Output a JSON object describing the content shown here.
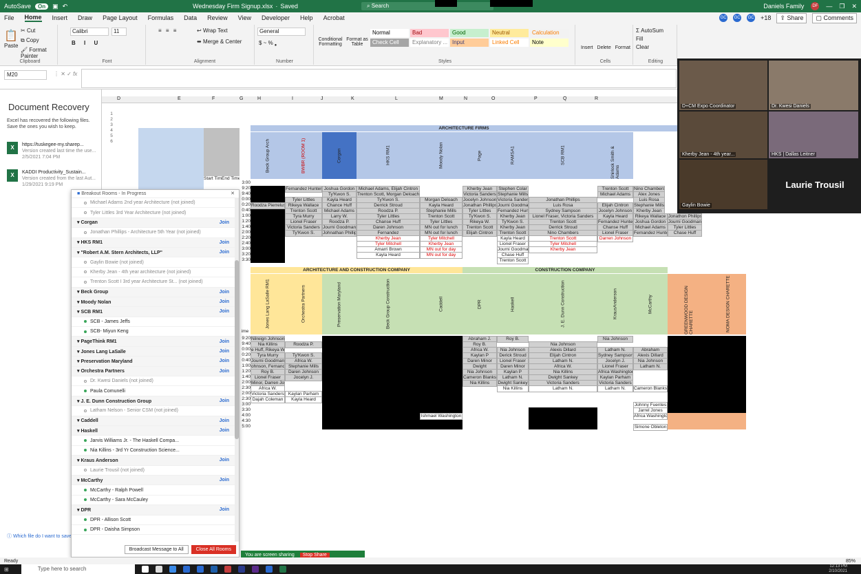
{
  "titlebar": {
    "autosave": "AutoSave",
    "autosave_state": "On",
    "filename": "Wednesday Firm Signup.xlsx",
    "saved": "Saved",
    "search": "Search",
    "account": "Daniels Family",
    "account_initials": "DF"
  },
  "menu": {
    "items": [
      "File",
      "Home",
      "Insert",
      "Draw",
      "Page Layout",
      "Formulas",
      "Data",
      "Review",
      "View",
      "Developer",
      "Help",
      "Acrobat"
    ],
    "participants_extra": "+18",
    "share": "Share",
    "comments": "Comments"
  },
  "ribbon": {
    "clipboard": {
      "paste": "Paste",
      "cut": "Cut",
      "copy": "Copy",
      "format_painter": "Format Painter",
      "label": "Clipboard"
    },
    "font": {
      "name": "Calibri",
      "size": "11",
      "label": "Font"
    },
    "alignment": {
      "wrap": "Wrap Text",
      "merge": "Merge & Center",
      "label": "Alignment"
    },
    "number": {
      "format": "General",
      "label": "Number"
    },
    "styles": {
      "cond": "Conditional Formatting",
      "fmt_table": "Format as Table",
      "label": "Styles",
      "items": [
        {
          "name": "Normal",
          "bg": "#ffffff",
          "fg": "#000000"
        },
        {
          "name": "Bad",
          "bg": "#ffc7ce",
          "fg": "#9c0006"
        },
        {
          "name": "Good",
          "bg": "#c6efce",
          "fg": "#006100"
        },
        {
          "name": "Neutral",
          "bg": "#ffeb9c",
          "fg": "#9c5700"
        },
        {
          "name": "Calculation",
          "bg": "#f2f2f2",
          "fg": "#fa7d00"
        },
        {
          "name": "Check Cell",
          "bg": "#a5a5a5",
          "fg": "#ffffff"
        },
        {
          "name": "Explanatory ...",
          "bg": "#ffffff",
          "fg": "#7f7f7f"
        },
        {
          "name": "Input",
          "bg": "#ffcc99",
          "fg": "#3f3f76"
        },
        {
          "name": "Linked Cell",
          "bg": "#ffffff",
          "fg": "#fa7d00"
        },
        {
          "name": "Note",
          "bg": "#ffffcc",
          "fg": "#000000"
        }
      ]
    },
    "cells": {
      "insert": "Insert",
      "delete": "Delete",
      "format": "Format",
      "label": "Cells"
    },
    "editing": {
      "autosum": "AutoSum",
      "fill": "Fill",
      "clear": "Clear",
      "sort": "Sort & Filter",
      "find": "Find & Select",
      "label": "Editing"
    },
    "analysis": {
      "analyze": "Analyze Data",
      "sensitivity": "Sensitivity"
    }
  },
  "formula": {
    "namebox": "M20",
    "fx": "fx"
  },
  "recovery": {
    "title": "Document Recovery",
    "desc": "Excel has recovered the following files. Save the ones you wish to keep.",
    "files": [
      {
        "name": "https://tuskegee-my.sharep...",
        "note": "Version created last time the use...",
        "date": "2/5/2021 7:04 PM"
      },
      {
        "name": "KADDI Productivity_Sustain...",
        "note": "Version created from the last Aut...",
        "date": "1/29/2021 9:19 PM"
      }
    ],
    "help": "Which file do I want to save?"
  },
  "columns": [
    "D",
    "E",
    "F",
    "G",
    "H",
    "I",
    "J",
    "K",
    "L",
    "M",
    "N",
    "O",
    "P",
    "Q",
    "R"
  ],
  "row_numbers": [
    "1",
    "2",
    "3",
    "4",
    "5",
    "6"
  ],
  "sheet": {
    "band1": "ARCHITECTURE FIRMS",
    "start_time": "Start Time",
    "end_time": "End Time",
    "firms1": [
      "Beck Group Arch",
      "BWBR (ROOM 1)",
      "Corgan",
      "HKS RM1",
      "Moody Nolan",
      "Page",
      "RAMSA1",
      "SCB RM1",
      "Shirlock Smith & Adams"
    ],
    "times1": [
      "3:00",
      "9:20",
      "9:40",
      "0:00",
      "0:20",
      "0:40",
      "1:00",
      "1:20",
      "1:40",
      "2:00",
      "2:20",
      "2:40",
      "3:00",
      "3:20",
      "3:30"
    ],
    "rows1": [
      [
        "",
        "Fernandez Hunter",
        "Joshua Gordon",
        "Michael Adams, Elijah Cintron",
        "",
        "Kherby Jean",
        "Stephen Colar",
        "",
        "Trenton Scott",
        "Nino Chambers"
      ],
      [
        "",
        "",
        "Ty'Kwon S.",
        "Trenton Scott, Morgan Deloach",
        "",
        "Victoria Sanders",
        "Stephanie Mills",
        "",
        "Michael Adams",
        "Alex Jones"
      ],
      [
        "",
        "Tyler Littles",
        "Kayla Heard",
        "Ty'Kwon S.",
        "Morgan Deloach",
        "Jocelyn Johnson",
        "Victoria Sanders",
        "Jonathan Phillips",
        "",
        "Luis Rosa"
      ],
      [
        "Roodza Pierrelus",
        "Rikeya Wallace",
        "Chance Huff",
        "Derrick Stroud",
        "Kayla Heard",
        "Jonathan Phillips",
        "Journi Goodman",
        "Luis Rosa",
        "Elijah Cintron",
        "Stephanie Mills"
      ],
      [
        "",
        "Trenton Scott",
        "Michael Adams",
        "Roodza P.",
        "Stephanie Mills",
        "Tyler Littles",
        "Fernandez Hunter",
        "Sydney Sampson",
        "Jocelyn Johnson",
        "Kherby Jean"
      ],
      [
        "",
        "Tyra Murry",
        "Larry W.",
        "Tyler Littles",
        "Trenton Scott",
        "Ty'Kwon S.",
        "Kherby Jean",
        "Lionel Fraser, Victoria Sanders",
        "Kayla Heard",
        "Roodza Pierrelus"
      ],
      [
        "",
        "Lionel Fraser",
        "Roodza P.",
        "Chanse Huff",
        "Tyler Littles",
        "Rikeya W.",
        "Ty'Kwon S.",
        "Trenton Scott",
        "Fernandez Hunter",
        "Victoria Sanders"
      ],
      [
        "",
        "Victoria Sanders",
        "Journi Goodman",
        "Daren Johnson",
        "MN out for lunch",
        "Trenton Scott",
        "Kherby Jean",
        "Derrick Stroud",
        "Chanse Huff",
        "Ty'Kwon S."
      ],
      [
        "",
        "Ty'Kwon S.",
        "Johnathan Phillips",
        "Fernandez",
        "MN out for lunch",
        "Elijah Cintron",
        "Trenton Scott",
        "Nino Chambers",
        "Lionel Fraser",
        "Luis Rosa"
      ],
      [
        "",
        "",
        "",
        "Kherby Jean",
        "Tyler Mitchell",
        "",
        "Kayla Heard",
        "Trenton Scott",
        "Darren Johnson",
        ""
      ],
      [
        "",
        "",
        "",
        "Tyler Mitchell",
        "Kherby Jean",
        "",
        "Lionel Fraser",
        "Tyler Mitchell",
        "",
        ""
      ],
      [
        "",
        "",
        "",
        "Amarri Brown",
        "MN out for day",
        "",
        "Journi Goodman",
        "Kherby Jean",
        "",
        ""
      ],
      [
        "",
        "",
        "",
        "Kayla Heard",
        "MN out for day",
        "",
        "Chase Huff",
        "",
        "",
        ""
      ],
      [
        "",
        "",
        "",
        "",
        "",
        "",
        "Trenton Scott",
        "",
        "",
        ""
      ]
    ],
    "extra_cols": [
      [
        "Rikeya Wallace",
        "Jonathon Phillips"
      ],
      [
        "Joshua Gordon",
        "Journi Goodman"
      ],
      [
        "Michael Adams",
        "Tyler Littles"
      ],
      [
        "Fernandez Hunter",
        "Chase Huff"
      ]
    ],
    "band2a": "ARCHITECTURE AND CONSTRUCTION COMPANY",
    "band2b": "CONSTRUCTION COMPANY",
    "firms2": [
      "Jones Lang LaSalle RM1",
      "Orchestra Partners",
      "Preservation Maryland",
      "Beck Group Construction",
      "Caddell",
      "DPR",
      "Haskell",
      "J. E. Dunn Construction",
      "KrausAnderson",
      "McCarthy",
      "GREENWOOD DESIGN CHARETTE",
      "NOMA DESIGN CHARETTE"
    ],
    "time_label": "ime",
    "times2": [
      "9:20",
      "9:40",
      "0:00",
      "0:20",
      "0:40",
      "1:00",
      "1:20",
      "1:40",
      "2:00",
      "2:30",
      "2:00",
      "2:30",
      "3:00",
      "3:30",
      "4:00",
      "4:30",
      "5:00"
    ],
    "rows2": [
      [
        "Nilreign Johnson",
        "",
        "",
        "",
        "",
        "Abraham J.",
        "Roy B.",
        "",
        "Nia Johnson",
        ""
      ],
      [
        "Nia Killins",
        "Roodza P.",
        "",
        "",
        "",
        "Roy B.",
        "",
        "Nia Johnson",
        "",
        ""
      ],
      [
        "e Huff, Rikeya Wallace",
        "",
        "",
        "",
        "",
        "Africa W.",
        "Nia Johnson",
        "Alexis Dillard",
        "Latham N.",
        "Abraham"
      ],
      [
        "Tyra Murry",
        "Ty'Kwon S.",
        "",
        "",
        "",
        "Kaylan P",
        "Derick Stroud",
        "Elijah Cintron",
        "Sydney Sampson",
        "Alexis Dillard"
      ],
      [
        "Journi Goodman",
        "Africa W.",
        "",
        "",
        "",
        "Daren Minor",
        "Lionel Fraser",
        "Latham N.",
        "Jocelyn J.",
        "Nia Johnson"
      ],
      [
        "ohnson, Fernande",
        "Stephanie Mills",
        "",
        "",
        "",
        "Dwight",
        "Daren Minor",
        "Africa W.",
        "Lionel Fraser",
        "Latham N."
      ],
      [
        "Roy B.",
        "Daren Johnson",
        "",
        "",
        "",
        "Nia Johnson",
        "Kaylan P",
        "Nia Killins",
        "Africa Washington",
        ""
      ],
      [
        "Lionel Fraser",
        "Jocelyn J.",
        "",
        "",
        "",
        "Cameron Blanks",
        "Latham N.",
        "Dwight Sankey",
        "Kaylan Parham",
        ""
      ],
      [
        "Minor, Darren Jo",
        "",
        "",
        "",
        "",
        "Nia Killins",
        "Dwight Sankey",
        "Victoria Sanders",
        "Victoria Sanders",
        ""
      ],
      [
        "Africa W.",
        "",
        "",
        "",
        "",
        "",
        "Nia Killins",
        "Latham N.",
        "Latham N.",
        "Cameron Blanks"
      ],
      [
        "Victoria Sanders",
        "Kaylan Parham",
        "",
        "",
        "",
        "",
        "",
        "",
        "",
        ""
      ],
      [
        "Dajah Coleman",
        "Kayla Heard",
        "",
        "",
        "",
        "",
        "",
        "",
        "",
        ""
      ],
      [
        "",
        "",
        "",
        "",
        "",
        "",
        "",
        "",
        "",
        "Johnny Fuentes"
      ],
      [
        "",
        "",
        "",
        "",
        "",
        "",
        "",
        "",
        "",
        "Jarrel Jones"
      ],
      [
        "",
        "",
        "",
        "",
        "Ishmael Washington",
        "",
        "",
        "",
        "",
        "Africa Washington"
      ],
      [
        "",
        "",
        "",
        "",
        "",
        "",
        "",
        "",
        "",
        ""
      ],
      [
        "",
        "",
        "",
        "",
        "",
        "",
        "",
        "",
        "",
        "Simone Obleton"
      ]
    ]
  },
  "breakout": {
    "title": "Breakout Rooms - In Progress",
    "rows": [
      {
        "t": "p",
        "label": "Michael Adams 2nd year Architecture (not joined)",
        "on": false
      },
      {
        "t": "p",
        "label": "Tyler Littles 3rd Year Architecture (not joined)",
        "on": false
      },
      {
        "t": "r",
        "label": "Corgan",
        "join": "Join"
      },
      {
        "t": "p",
        "label": "Jonathan Phillips - Architecture 5th Year (not joined)",
        "on": false
      },
      {
        "t": "r",
        "label": "HKS RM1",
        "join": "Join"
      },
      {
        "t": "r",
        "label": "\"Robert A.M. Stern Architects, LLP\"",
        "join": "Join"
      },
      {
        "t": "p",
        "label": "Gaylin Bowie (not joined)",
        "on": false
      },
      {
        "t": "p",
        "label": "Kherby Jean - 4th year architecture (not joined)",
        "on": false
      },
      {
        "t": "p",
        "label": "Trenton Scott I 3rd year Architecture St... (not joined)",
        "on": false
      },
      {
        "t": "r",
        "label": "Beck Group",
        "join": "Join"
      },
      {
        "t": "r",
        "label": "Moody Nolan",
        "join": "Join"
      },
      {
        "t": "r",
        "label": "SCB RM1",
        "join": "Join"
      },
      {
        "t": "p",
        "label": "SCB - James Jeffs",
        "on": true
      },
      {
        "t": "p",
        "label": "SCB- Miyun Keng",
        "on": true
      },
      {
        "t": "r",
        "label": "PageThink RM1",
        "join": "Join"
      },
      {
        "t": "r",
        "label": "Jones Lang LaSalle",
        "join": "Join"
      },
      {
        "t": "r",
        "label": "Preservation Maryland",
        "join": "Join"
      },
      {
        "t": "r",
        "label": "Orchestra Partners",
        "join": "Join"
      },
      {
        "t": "p",
        "label": "Dr. Kwesi Daniels (not joined)",
        "on": false
      },
      {
        "t": "p",
        "label": "Paula Comunelli",
        "on": true
      },
      {
        "t": "r",
        "label": "J. E. Dunn Construction Group",
        "join": "Join"
      },
      {
        "t": "p",
        "label": "Latham Nelson - Senior CSM (not joined)",
        "on": false
      },
      {
        "t": "r",
        "label": "Caddell",
        "join": "Join"
      },
      {
        "t": "r",
        "label": "Haskell",
        "join": "Join"
      },
      {
        "t": "p",
        "label": "Jarvis Williams Jr. - The Haskell Compa...",
        "on": true
      },
      {
        "t": "p",
        "label": "Nia Killins - 3rd Yr Construction Science...",
        "on": true
      },
      {
        "t": "r",
        "label": "Kraus Anderson",
        "join": "Join"
      },
      {
        "t": "p",
        "label": "Laurie Trousil (not joined)",
        "on": false
      },
      {
        "t": "r",
        "label": "McCarthy",
        "join": "Join"
      },
      {
        "t": "p",
        "label": "McCarthy - Ralph Powell",
        "on": true
      },
      {
        "t": "p",
        "label": "McCarthy - Sara McCauley",
        "on": true
      },
      {
        "t": "r",
        "label": "DPR",
        "join": "Join"
      },
      {
        "t": "p",
        "label": "DPR - Allison Scott",
        "on": true
      },
      {
        "t": "p",
        "label": "DPR - Daisha Simpson",
        "on": true
      }
    ],
    "broadcast": "Broadcast Message to All",
    "close": "Close All Rooms"
  },
  "video": {
    "tiles": [
      "D+CM Expo Coordinator",
      "Dr. Kwesi Daniels",
      "Kherby Jean - 4th year...",
      "HKS | Dallas Leitner",
      "Gaylin Bowie"
    ],
    "speaker": "Laurie Trousil"
  },
  "share": {
    "text": "You are screen sharing",
    "stop": "Stop Share"
  },
  "status": {
    "ready": "Ready",
    "zoom": "85%"
  },
  "taskbar": {
    "search": "Type here to search",
    "time": "12:13 PM",
    "date": "2/10/2021"
  }
}
